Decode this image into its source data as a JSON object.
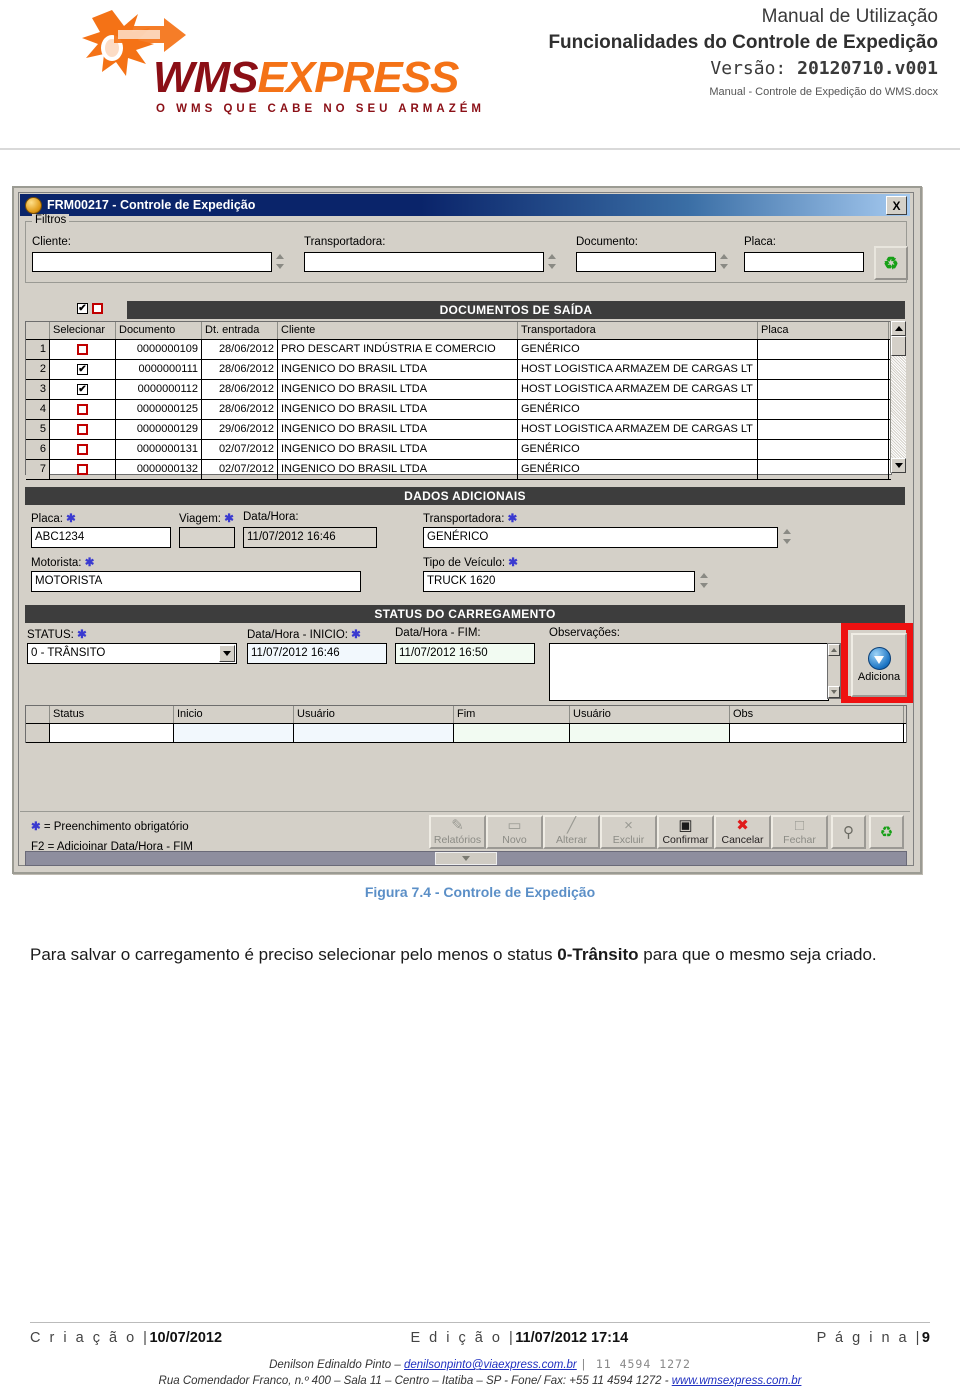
{
  "header": {
    "logo_word_1": "WMS",
    "logo_word_2": "EXPRESS",
    "logo_tagline": "O WMS QUE CABE NO SEU ARMAZÉM",
    "line1": "Manual de Utilização",
    "line2": "Funcionalidades do Controle de Expedição",
    "line3_label": "Versão:",
    "line3_value": "20120710.v001",
    "line4": "Manual - Controle de Expedição do WMS.docx"
  },
  "window": {
    "title": "FRM00217 - Controle de Expedição",
    "close_label": "X"
  },
  "filtros": {
    "legend": "Filtros",
    "cliente_label": "Cliente:",
    "cliente_value": "",
    "transportadora_label": "Transportadora:",
    "transportadora_value": "",
    "documento_label": "Documento:",
    "documento_value": "",
    "placa_label": "Placa:",
    "placa_value": "",
    "refresh_icon": "recycle-icon"
  },
  "documentos": {
    "section_title": "DOCUMENTOS DE SAÍDA",
    "header_checkbox_checked": "✔",
    "columns": [
      "Selecionar",
      "Documento",
      "Dt. entrada",
      "Cliente",
      "Transportadora",
      "Placa"
    ],
    "rows": [
      {
        "n": "1",
        "sel": false,
        "documento": "0000000109",
        "dt": "28/06/2012",
        "cliente": "PRO DESCART INDÚSTRIA E COMERCIO",
        "transportadora": "GENÉRICO",
        "placa": ""
      },
      {
        "n": "2",
        "sel": true,
        "documento": "0000000111",
        "dt": "28/06/2012",
        "cliente": "INGENICO DO BRASIL LTDA",
        "transportadora": "HOST LOGISTICA ARMAZEM DE CARGAS LT",
        "placa": ""
      },
      {
        "n": "3",
        "sel": true,
        "documento": "0000000112",
        "dt": "28/06/2012",
        "cliente": "INGENICO DO BRASIL LTDA",
        "transportadora": "HOST LOGISTICA ARMAZEM DE CARGAS LT",
        "placa": ""
      },
      {
        "n": "4",
        "sel": false,
        "documento": "0000000125",
        "dt": "28/06/2012",
        "cliente": "INGENICO DO BRASIL LTDA",
        "transportadora": "GENÉRICO",
        "placa": ""
      },
      {
        "n": "5",
        "sel": false,
        "documento": "0000000129",
        "dt": "29/06/2012",
        "cliente": "INGENICO DO BRASIL LTDA",
        "transportadora": "HOST LOGISTICA ARMAZEM DE CARGAS LT",
        "placa": ""
      },
      {
        "n": "6",
        "sel": false,
        "documento": "0000000131",
        "dt": "02/07/2012",
        "cliente": "INGENICO DO BRASIL LTDA",
        "transportadora": "GENÉRICO",
        "placa": ""
      },
      {
        "n": "7",
        "sel": false,
        "documento": "0000000132",
        "dt": "02/07/2012",
        "cliente": "INGENICO DO BRASIL LTDA",
        "transportadora": "GENÉRICO",
        "placa": ""
      }
    ]
  },
  "dados_adicionais": {
    "section_title": "DADOS ADICIONAIS",
    "placa_label": "Placa:",
    "placa_value": "ABC1234",
    "viagem_label": "Viagem:",
    "viagem_value": "",
    "datahora_label": "Data/Hora:",
    "datahora_value": "11/07/2012 16:46",
    "transportadora_label": "Transportadora:",
    "transportadora_value": "GENÉRICO",
    "motorista_label": "Motorista:",
    "motorista_value": "MOTORISTA",
    "tipo_veiculo_label": "Tipo de Veículo:",
    "tipo_veiculo_value": "TRUCK 1620"
  },
  "status_carregamento": {
    "section_title": "STATUS DO CARREGAMENTO",
    "status_label": "STATUS:",
    "status_value": "0 - TRÂNSITO",
    "inicio_label": "Data/Hora - INICIO:",
    "inicio_value": "11/07/2012 16:46",
    "fim_label": "Data/Hora - FIM:",
    "fim_value": "11/07/2012 16:50",
    "obs_label": "Observações:",
    "obs_value": "",
    "adiciona_label": "Adiciona",
    "adiciona_icon": "download-arrow-icon",
    "columns": [
      "Status",
      "Inicio",
      "Usuário",
      "Fim",
      "Usuário",
      "Obs"
    ],
    "rows": [
      {
        "status": "",
        "inicio": "",
        "usuario1": "",
        "fim": "",
        "usuario2": "",
        "obs": ""
      }
    ]
  },
  "footer_bar": {
    "legend1": "✱ = Preenchimento obrigatório",
    "legend2": "F2 = Adicioinar Data/Hora - FIM",
    "buttons": [
      {
        "label": "Relatórios",
        "icon": "report-icon",
        "disabled": true
      },
      {
        "label": "Novo",
        "icon": "new-icon",
        "disabled": true
      },
      {
        "label": "Alterar",
        "icon": "edit-icon",
        "disabled": true
      },
      {
        "label": "Excluir",
        "icon": "delete-x-icon",
        "disabled": true
      },
      {
        "label": "Confirmar",
        "icon": "save-floppy-icon",
        "disabled": false
      },
      {
        "label": "Cancelar",
        "icon": "cancel-x-icon",
        "disabled": false
      },
      {
        "label": "Fechar",
        "icon": "close-window-icon",
        "disabled": true
      }
    ],
    "extra_buttons": [
      {
        "icon": "wrench-icon"
      },
      {
        "icon": "recycle-icon"
      }
    ]
  },
  "caption": "Figura 7.4 - Controle de Expedição",
  "body_text": {
    "part1": "Para salvar o carregamento é preciso selecionar pelo menos o status ",
    "bold": "0-Trânsito",
    "part2": " para que o mesmo seja criado."
  },
  "page_footer": {
    "criacao_label": "C r i a ç ã o |",
    "criacao_value": "10/07/2012",
    "edicao_label": "E d i ç ã o |",
    "edicao_value": "11/07/2012 17:14",
    "pagina_label": "P á g i n a |",
    "pagina_value": "9",
    "contact_name": "Denilson Edinaldo Pinto – ",
    "contact_email": "denilsonpinto@viaexpress.com.br",
    "contact_phone": "| 11  4594  1272",
    "address": "Rua Comendador Franco, n.º 400 – Sala 11 – Centro – Itatiba – SP - Fone/ Fax: +55 11 4594 1272 - ",
    "site": "www.wmsexpress.com.br"
  },
  "colors": {
    "accent_orange": "#f47216",
    "accent_dark_red": "#8b0f16",
    "caption_blue": "#5b8fc7",
    "highlight_red": "#ee1111",
    "titlebar_blue": "#0a246a"
  }
}
